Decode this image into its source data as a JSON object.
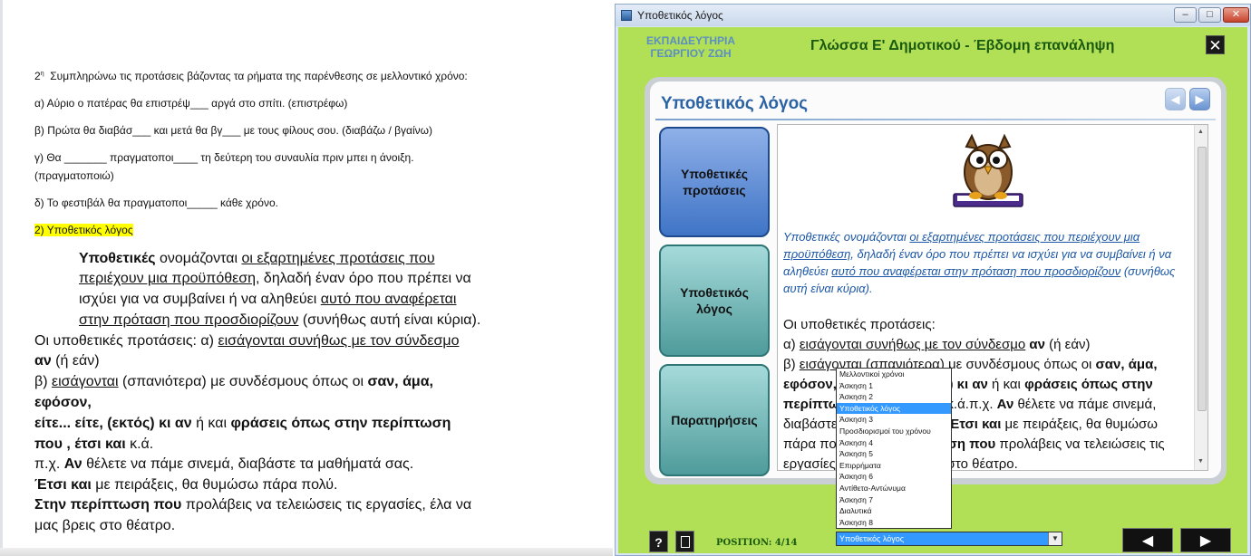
{
  "document": {
    "exercise_heading_num": "2",
    "exercise_heading_sup": "η",
    "exercise_heading_text": "Συμπληρώνω τις προτάσεις βάζοντας τα ρήματα της παρένθεσης σε μελλοντικό χρόνο:",
    "ex_a": "α) Αύριο ο πατέρας θα επιστρέψ___ αργά στο σπίτι. (επιστρέφω)",
    "ex_b": "β) Πρώτα θα διαβάσ___ και μετά θα βγ___ με τους φίλους σου. (διαβάζω / βγαίνω)",
    "ex_c1": "γ) Θα _______ πραγματοποι____ τη δεύτερη του συναυλία πριν μπει η άνοιξη.",
    "ex_c2": "(πραγματοποιώ)",
    "ex_d": "δ) Το φεστιβάλ θα πραγματοποι_____ κάθε χρόνο.",
    "section_title": "2) Υποθετικός λόγος",
    "l1_b": "Υποθετικές",
    "l1_t": " ονομάζονται ",
    "l1_u": "οι εξαρτημένες προτάσεις που",
    "l2_u": "περιέχουν μια προϋπόθεση",
    "l2_t": ", δηλαδή έναν όρο που πρέπει να",
    "l3_t": "ισχύει για να συμβαίνει ή να αληθεύει ",
    "l3_u": "αυτό που αναφέρεται",
    "l4_u": "στην πρόταση που προσδιορίζουν",
    "l4_t": " (συνήθως αυτή είναι κύρια).",
    "l5_t": "Οι υποθετικές προτάσεις: α) ",
    "l5_u": "εισάγονται συνήθως με τον σύνδεσμο",
    "l6_b": "αν",
    "l6_t": " (ή εάν)",
    "l7_t1": "β) ",
    "l7_u": "εισάγονται",
    "l7_t2": " (σπανιότερα) με συνδέσμους όπως οι ",
    "l7_b": "σαν, άμα,",
    "l8_b": "εφόσον,",
    "l9_b1": "είτε... είτε, (εκτός) κι αν",
    "l9_t": " ή και ",
    "l9_b2": "φράσεις όπως στην περίπτωση",
    "l10_b": "που , έτσι και",
    "l10_t": " κ.ά.",
    "l11_t1": "π.χ. ",
    "l11_b": "Αν",
    "l11_t2": " θέλετε να πάμε σινεμά, διαβάστε τα μαθήματά σας.",
    "l12_b": "Έτσι και",
    "l12_t": " με πειράξεις, θα θυμώσω πάρα πολύ.",
    "l13_b": "Στην περίπτωση που",
    "l13_t": " προλάβεις να τελειώσεις τις εργασίες, έλα να",
    "l14_t": "μας βρεις στο θέατρο."
  },
  "window": {
    "title": "Υποθετικός λόγος",
    "min": "–",
    "max": "□",
    "close": "✕"
  },
  "app": {
    "school_line1": "ΕΚΠΑΙΔΕΥΤΗΡΙΑ",
    "school_line2": "ΓΕΩΡΓΙΟΥ ΖΩΗ",
    "title": "Γλώσσα Ε' Δημοτικού - Έβδομη επανάληψη",
    "close_label": "✕",
    "panel_title": "Υποθετικός λόγος",
    "nav_prev": "◀",
    "nav_next": "▶",
    "side_buttons": [
      {
        "line1": "Υποθετικές",
        "line2": "προτάσεις"
      },
      {
        "line1": "Υποθετικός",
        "line2": "λόγος"
      },
      {
        "line1": "Παρατηρήσεις",
        "line2": ""
      }
    ],
    "italic": {
      "t1": "Υποθετικές ονομάζονται ",
      "u1": "οι εξαρτημένες προτάσεις που περιέχουν μια προϋπόθεση",
      "t2": ", δηλαδή έναν όρο που πρέπει να ισχύει για να συμβαίνει ή να αληθεύει ",
      "u2": "αυτό που αναφέρεται στην πρόταση που προσδιορίζουν",
      "t3": " (συνήθως αυτή είναι κύρια)."
    },
    "c1": "Οι υποθετικές προτάσεις:",
    "c2_t1": "α) ",
    "c2_u": "εισάγονται συνήθως με τον σύνδεσμο",
    "c2_b": " αν",
    "c2_t2": " (ή εάν)",
    "c3_t1": "β) ",
    "c3_u": "εισάγονται",
    "c3_t2": " (σπανιότερα) με συνδέσμους όπως οι ",
    "c3_b": "σαν, άμα,",
    "c4_b1": "εφόσον, είτε... είτε, (εκτός) κι αν",
    "c4_t": " ή και ",
    "c4_b2": "φράσεις όπως στην",
    "c5_b": "περίπτωση που, έτσι και",
    "c5_t1": " κ.ά.π.χ. ",
    "c5_b2": "Αν",
    "c5_t2": " θέλετε να πάμε σινεμά,",
    "c6_t1": "διαβάστε τα μαθήματά σας.",
    "c6_b": "Έτσι και",
    "c6_t2": " με πειράξεις, θα θυμώσω",
    "c7_t1": "πάρα πολύ. ",
    "c7_b": "Στην περίπτωση που",
    "c7_t2": " προλάβεις να τελειώσεις τις",
    "c8_t": "εργασίες, έλα να μας βρεις στο θέατρο.",
    "dropdown_options": [
      "Μελλοντικοί χρόνοι",
      "Άσκηση 1",
      "Άσκηση 2",
      "Υποθετικός λόγος",
      "Άσκηση 3",
      "Προσδιορισμοί του χρόνου",
      "Άσκηση 4",
      "Άσκηση 5",
      "Επιρρήματα",
      "Άσκηση 6",
      "Αντίθετα-Αντώνυμα",
      "Άσκηση 7",
      "Διαλυτικά",
      "Άσκηση 8"
    ],
    "dropdown_selected": "Υποθετικός λόγος",
    "help_label": "?",
    "position": "POSITION: 4/14",
    "bottom_prev": "◀",
    "bottom_next": "▶"
  }
}
